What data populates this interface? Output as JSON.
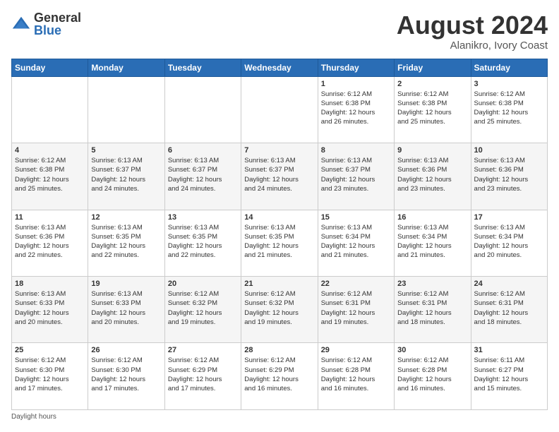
{
  "logo": {
    "general": "General",
    "blue": "Blue"
  },
  "header": {
    "month_year": "August 2024",
    "location": "Alanikro, Ivory Coast"
  },
  "days_of_week": [
    "Sunday",
    "Monday",
    "Tuesday",
    "Wednesday",
    "Thursday",
    "Friday",
    "Saturday"
  ],
  "weeks": [
    [
      {
        "day": "",
        "info": ""
      },
      {
        "day": "",
        "info": ""
      },
      {
        "day": "",
        "info": ""
      },
      {
        "day": "",
        "info": ""
      },
      {
        "day": "1",
        "info": "Sunrise: 6:12 AM\nSunset: 6:38 PM\nDaylight: 12 hours\nand 26 minutes."
      },
      {
        "day": "2",
        "info": "Sunrise: 6:12 AM\nSunset: 6:38 PM\nDaylight: 12 hours\nand 25 minutes."
      },
      {
        "day": "3",
        "info": "Sunrise: 6:12 AM\nSunset: 6:38 PM\nDaylight: 12 hours\nand 25 minutes."
      }
    ],
    [
      {
        "day": "4",
        "info": "Sunrise: 6:12 AM\nSunset: 6:38 PM\nDaylight: 12 hours\nand 25 minutes."
      },
      {
        "day": "5",
        "info": "Sunrise: 6:13 AM\nSunset: 6:37 PM\nDaylight: 12 hours\nand 24 minutes."
      },
      {
        "day": "6",
        "info": "Sunrise: 6:13 AM\nSunset: 6:37 PM\nDaylight: 12 hours\nand 24 minutes."
      },
      {
        "day": "7",
        "info": "Sunrise: 6:13 AM\nSunset: 6:37 PM\nDaylight: 12 hours\nand 24 minutes."
      },
      {
        "day": "8",
        "info": "Sunrise: 6:13 AM\nSunset: 6:37 PM\nDaylight: 12 hours\nand 23 minutes."
      },
      {
        "day": "9",
        "info": "Sunrise: 6:13 AM\nSunset: 6:36 PM\nDaylight: 12 hours\nand 23 minutes."
      },
      {
        "day": "10",
        "info": "Sunrise: 6:13 AM\nSunset: 6:36 PM\nDaylight: 12 hours\nand 23 minutes."
      }
    ],
    [
      {
        "day": "11",
        "info": "Sunrise: 6:13 AM\nSunset: 6:36 PM\nDaylight: 12 hours\nand 22 minutes."
      },
      {
        "day": "12",
        "info": "Sunrise: 6:13 AM\nSunset: 6:35 PM\nDaylight: 12 hours\nand 22 minutes."
      },
      {
        "day": "13",
        "info": "Sunrise: 6:13 AM\nSunset: 6:35 PM\nDaylight: 12 hours\nand 22 minutes."
      },
      {
        "day": "14",
        "info": "Sunrise: 6:13 AM\nSunset: 6:35 PM\nDaylight: 12 hours\nand 21 minutes."
      },
      {
        "day": "15",
        "info": "Sunrise: 6:13 AM\nSunset: 6:34 PM\nDaylight: 12 hours\nand 21 minutes."
      },
      {
        "day": "16",
        "info": "Sunrise: 6:13 AM\nSunset: 6:34 PM\nDaylight: 12 hours\nand 21 minutes."
      },
      {
        "day": "17",
        "info": "Sunrise: 6:13 AM\nSunset: 6:34 PM\nDaylight: 12 hours\nand 20 minutes."
      }
    ],
    [
      {
        "day": "18",
        "info": "Sunrise: 6:13 AM\nSunset: 6:33 PM\nDaylight: 12 hours\nand 20 minutes."
      },
      {
        "day": "19",
        "info": "Sunrise: 6:13 AM\nSunset: 6:33 PM\nDaylight: 12 hours\nand 20 minutes."
      },
      {
        "day": "20",
        "info": "Sunrise: 6:12 AM\nSunset: 6:32 PM\nDaylight: 12 hours\nand 19 minutes."
      },
      {
        "day": "21",
        "info": "Sunrise: 6:12 AM\nSunset: 6:32 PM\nDaylight: 12 hours\nand 19 minutes."
      },
      {
        "day": "22",
        "info": "Sunrise: 6:12 AM\nSunset: 6:31 PM\nDaylight: 12 hours\nand 19 minutes."
      },
      {
        "day": "23",
        "info": "Sunrise: 6:12 AM\nSunset: 6:31 PM\nDaylight: 12 hours\nand 18 minutes."
      },
      {
        "day": "24",
        "info": "Sunrise: 6:12 AM\nSunset: 6:31 PM\nDaylight: 12 hours\nand 18 minutes."
      }
    ],
    [
      {
        "day": "25",
        "info": "Sunrise: 6:12 AM\nSunset: 6:30 PM\nDaylight: 12 hours\nand 17 minutes."
      },
      {
        "day": "26",
        "info": "Sunrise: 6:12 AM\nSunset: 6:30 PM\nDaylight: 12 hours\nand 17 minutes."
      },
      {
        "day": "27",
        "info": "Sunrise: 6:12 AM\nSunset: 6:29 PM\nDaylight: 12 hours\nand 17 minutes."
      },
      {
        "day": "28",
        "info": "Sunrise: 6:12 AM\nSunset: 6:29 PM\nDaylight: 12 hours\nand 16 minutes."
      },
      {
        "day": "29",
        "info": "Sunrise: 6:12 AM\nSunset: 6:28 PM\nDaylight: 12 hours\nand 16 minutes."
      },
      {
        "day": "30",
        "info": "Sunrise: 6:12 AM\nSunset: 6:28 PM\nDaylight: 12 hours\nand 16 minutes."
      },
      {
        "day": "31",
        "info": "Sunrise: 6:11 AM\nSunset: 6:27 PM\nDaylight: 12 hours\nand 15 minutes."
      }
    ]
  ],
  "footer": {
    "daylight_label": "Daylight hours"
  }
}
